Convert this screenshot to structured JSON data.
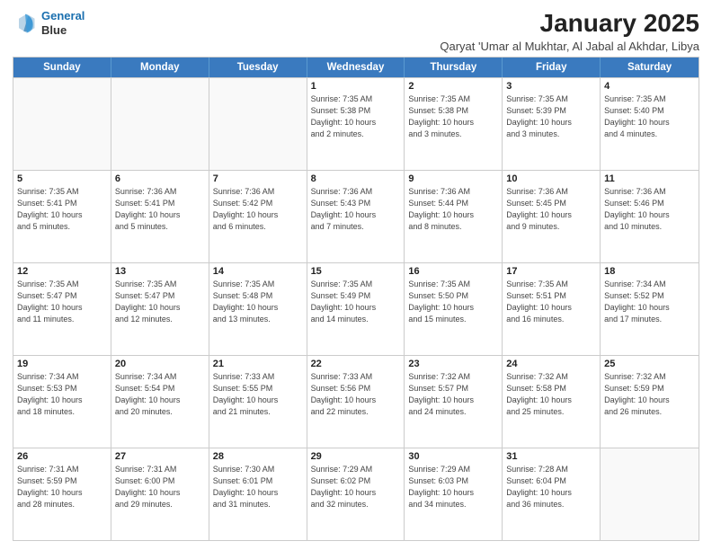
{
  "logo": {
    "line1": "General",
    "line2": "Blue"
  },
  "title": "January 2025",
  "subtitle": "Qaryat 'Umar al Mukhtar, Al Jabal al Akhdar, Libya",
  "header_days": [
    "Sunday",
    "Monday",
    "Tuesday",
    "Wednesday",
    "Thursday",
    "Friday",
    "Saturday"
  ],
  "rows": [
    [
      {
        "date": "",
        "info": ""
      },
      {
        "date": "",
        "info": ""
      },
      {
        "date": "",
        "info": ""
      },
      {
        "date": "1",
        "info": "Sunrise: 7:35 AM\nSunset: 5:38 PM\nDaylight: 10 hours\nand 2 minutes."
      },
      {
        "date": "2",
        "info": "Sunrise: 7:35 AM\nSunset: 5:38 PM\nDaylight: 10 hours\nand 3 minutes."
      },
      {
        "date": "3",
        "info": "Sunrise: 7:35 AM\nSunset: 5:39 PM\nDaylight: 10 hours\nand 3 minutes."
      },
      {
        "date": "4",
        "info": "Sunrise: 7:35 AM\nSunset: 5:40 PM\nDaylight: 10 hours\nand 4 minutes."
      }
    ],
    [
      {
        "date": "5",
        "info": "Sunrise: 7:35 AM\nSunset: 5:41 PM\nDaylight: 10 hours\nand 5 minutes."
      },
      {
        "date": "6",
        "info": "Sunrise: 7:36 AM\nSunset: 5:41 PM\nDaylight: 10 hours\nand 5 minutes."
      },
      {
        "date": "7",
        "info": "Sunrise: 7:36 AM\nSunset: 5:42 PM\nDaylight: 10 hours\nand 6 minutes."
      },
      {
        "date": "8",
        "info": "Sunrise: 7:36 AM\nSunset: 5:43 PM\nDaylight: 10 hours\nand 7 minutes."
      },
      {
        "date": "9",
        "info": "Sunrise: 7:36 AM\nSunset: 5:44 PM\nDaylight: 10 hours\nand 8 minutes."
      },
      {
        "date": "10",
        "info": "Sunrise: 7:36 AM\nSunset: 5:45 PM\nDaylight: 10 hours\nand 9 minutes."
      },
      {
        "date": "11",
        "info": "Sunrise: 7:36 AM\nSunset: 5:46 PM\nDaylight: 10 hours\nand 10 minutes."
      }
    ],
    [
      {
        "date": "12",
        "info": "Sunrise: 7:35 AM\nSunset: 5:47 PM\nDaylight: 10 hours\nand 11 minutes."
      },
      {
        "date": "13",
        "info": "Sunrise: 7:35 AM\nSunset: 5:47 PM\nDaylight: 10 hours\nand 12 minutes."
      },
      {
        "date": "14",
        "info": "Sunrise: 7:35 AM\nSunset: 5:48 PM\nDaylight: 10 hours\nand 13 minutes."
      },
      {
        "date": "15",
        "info": "Sunrise: 7:35 AM\nSunset: 5:49 PM\nDaylight: 10 hours\nand 14 minutes."
      },
      {
        "date": "16",
        "info": "Sunrise: 7:35 AM\nSunset: 5:50 PM\nDaylight: 10 hours\nand 15 minutes."
      },
      {
        "date": "17",
        "info": "Sunrise: 7:35 AM\nSunset: 5:51 PM\nDaylight: 10 hours\nand 16 minutes."
      },
      {
        "date": "18",
        "info": "Sunrise: 7:34 AM\nSunset: 5:52 PM\nDaylight: 10 hours\nand 17 minutes."
      }
    ],
    [
      {
        "date": "19",
        "info": "Sunrise: 7:34 AM\nSunset: 5:53 PM\nDaylight: 10 hours\nand 18 minutes."
      },
      {
        "date": "20",
        "info": "Sunrise: 7:34 AM\nSunset: 5:54 PM\nDaylight: 10 hours\nand 20 minutes."
      },
      {
        "date": "21",
        "info": "Sunrise: 7:33 AM\nSunset: 5:55 PM\nDaylight: 10 hours\nand 21 minutes."
      },
      {
        "date": "22",
        "info": "Sunrise: 7:33 AM\nSunset: 5:56 PM\nDaylight: 10 hours\nand 22 minutes."
      },
      {
        "date": "23",
        "info": "Sunrise: 7:32 AM\nSunset: 5:57 PM\nDaylight: 10 hours\nand 24 minutes."
      },
      {
        "date": "24",
        "info": "Sunrise: 7:32 AM\nSunset: 5:58 PM\nDaylight: 10 hours\nand 25 minutes."
      },
      {
        "date": "25",
        "info": "Sunrise: 7:32 AM\nSunset: 5:59 PM\nDaylight: 10 hours\nand 26 minutes."
      }
    ],
    [
      {
        "date": "26",
        "info": "Sunrise: 7:31 AM\nSunset: 5:59 PM\nDaylight: 10 hours\nand 28 minutes."
      },
      {
        "date": "27",
        "info": "Sunrise: 7:31 AM\nSunset: 6:00 PM\nDaylight: 10 hours\nand 29 minutes."
      },
      {
        "date": "28",
        "info": "Sunrise: 7:30 AM\nSunset: 6:01 PM\nDaylight: 10 hours\nand 31 minutes."
      },
      {
        "date": "29",
        "info": "Sunrise: 7:29 AM\nSunset: 6:02 PM\nDaylight: 10 hours\nand 32 minutes."
      },
      {
        "date": "30",
        "info": "Sunrise: 7:29 AM\nSunset: 6:03 PM\nDaylight: 10 hours\nand 34 minutes."
      },
      {
        "date": "31",
        "info": "Sunrise: 7:28 AM\nSunset: 6:04 PM\nDaylight: 10 hours\nand 36 minutes."
      },
      {
        "date": "",
        "info": ""
      }
    ]
  ]
}
